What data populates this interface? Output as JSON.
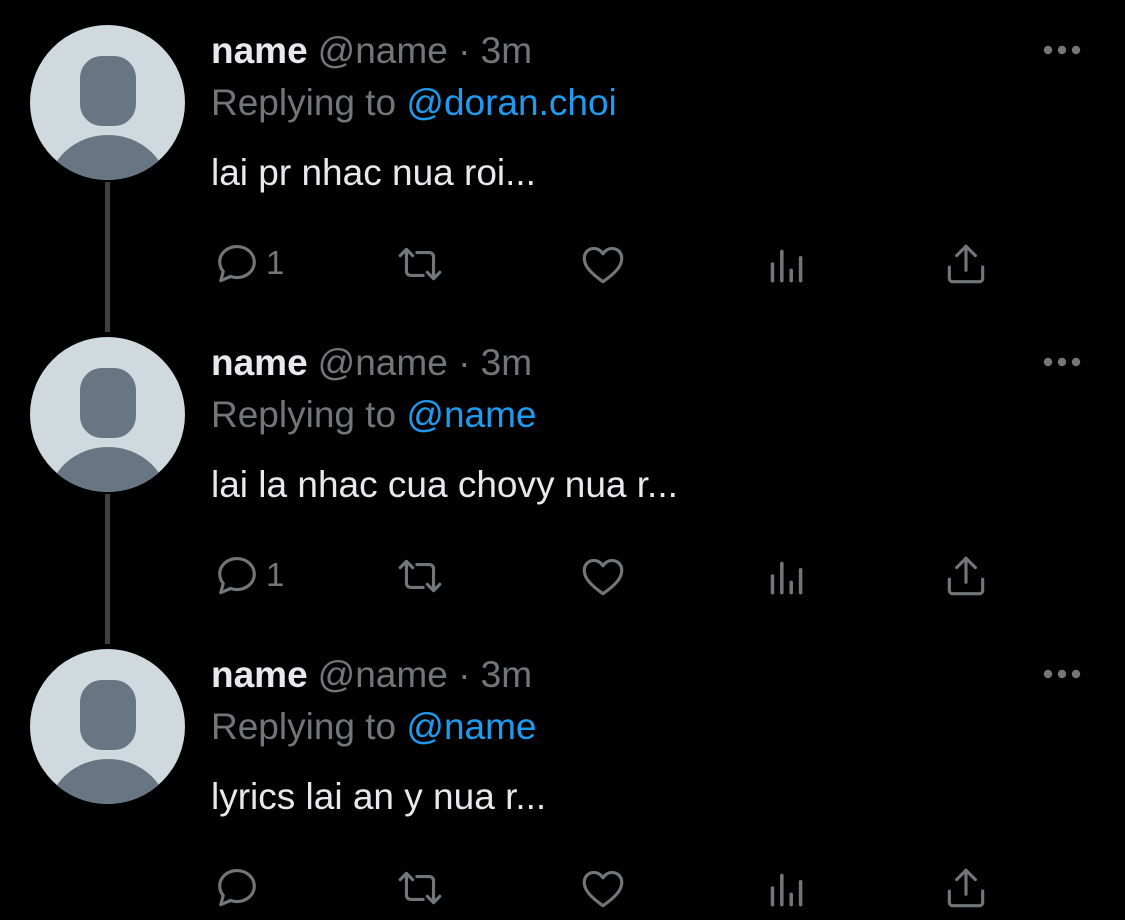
{
  "colors": {
    "background": "#000000",
    "primary_text": "#e7e9ea",
    "secondary_text": "#71767b",
    "accent": "#1d9bf0",
    "avatar_bg": "#cfd9de",
    "avatar_figure": "#687684",
    "thread_line": "#3e4144"
  },
  "icons": {
    "more": "more-horizontal-icon",
    "reply": "comment-icon",
    "retweet": "retweet-icon",
    "like": "heart-icon",
    "views": "bar-chart-icon",
    "share": "share-upload-icon"
  },
  "tweets": [
    {
      "display_name": "name",
      "handle": "@name",
      "separator": "·",
      "time": "3m",
      "replying_label": "Replying to",
      "replying_to": "@doran.choi",
      "text": "lai pr nhac nua roi...",
      "reply_count": "1"
    },
    {
      "display_name": "name",
      "handle": "@name",
      "separator": "·",
      "time": "3m",
      "replying_label": "Replying to",
      "replying_to": "@name",
      "text": "lai la nhac cua chovy nua r...",
      "reply_count": "1"
    },
    {
      "display_name": "name",
      "handle": "@name",
      "separator": "·",
      "time": "3m",
      "replying_label": "Replying to",
      "replying_to": "@name",
      "text": "lyrics lai an y nua r...",
      "reply_count": ""
    }
  ]
}
